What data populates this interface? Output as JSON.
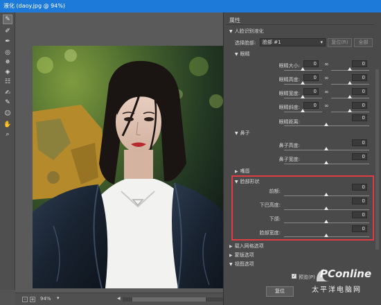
{
  "window": {
    "title": "液化 (daoy.jpg @ 94%)"
  },
  "status_bar": {
    "zoom": "94%",
    "minus": "-",
    "plus": "+"
  },
  "panel": {
    "title": "属性",
    "face_aware": {
      "header": "人脸识别液化",
      "select_label": "选择脸部:",
      "select_value": "脸部 #1",
      "reset_button": "复位(R)",
      "all_button": "全部"
    },
    "eyes": {
      "header": "眼睛",
      "rows": [
        {
          "label": "眼睛大小:",
          "left": "0",
          "right": "0",
          "linked": true
        },
        {
          "label": "眼睛高度:",
          "left": "0",
          "right": "0",
          "linked": true
        },
        {
          "label": "眼睛宽度:",
          "left": "0",
          "right": "0",
          "linked": true
        },
        {
          "label": "眼睛斜度:",
          "left": "0",
          "right": "0",
          "linked": true
        },
        {
          "label": "眼睛距离:",
          "value": "0"
        }
      ]
    },
    "nose": {
      "header": "鼻子",
      "rows": [
        {
          "label": "鼻子高度:",
          "value": "0"
        },
        {
          "label": "鼻子宽度:",
          "value": "0"
        }
      ]
    },
    "smile": {
      "header": "嘴唇"
    },
    "face_shape": {
      "header": "脸部形状",
      "rows": [
        {
          "label": "前额:",
          "value": "0"
        },
        {
          "label": "下巴高度:",
          "value": "0"
        },
        {
          "label": "下颌:",
          "value": "0"
        },
        {
          "label": "脸部宽度:",
          "value": "0"
        }
      ]
    },
    "sections": [
      "载入网格选项",
      "蒙版选项",
      "视图选项"
    ],
    "preview_label": "预览(P)",
    "preview_checked": true,
    "reset_label": "复位"
  },
  "watermark": {
    "brand": "PConline",
    "sub": "太平洋电脑网"
  }
}
